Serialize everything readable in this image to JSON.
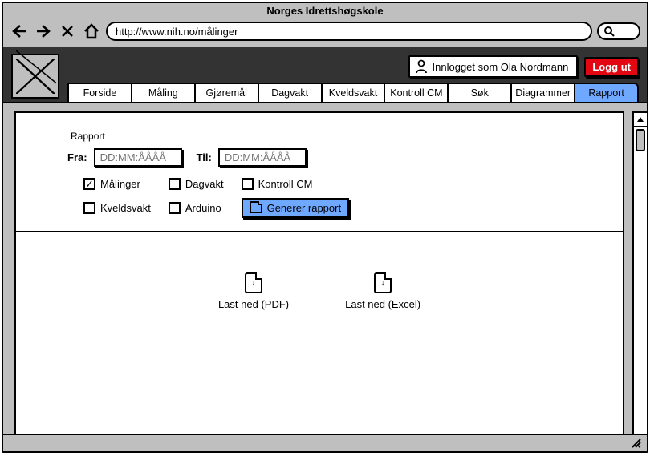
{
  "window": {
    "title": "Norges Idrettshøgskole",
    "url": "http://www.nih.no/målinger"
  },
  "header": {
    "logged_in_text": "Innlogget som Ola Nordmann",
    "logout_label": "Logg ut"
  },
  "tabs": [
    {
      "label": "Forside"
    },
    {
      "label": "Måling"
    },
    {
      "label": "Gjøremål"
    },
    {
      "label": "Dagvakt"
    },
    {
      "label": "Kveldsvakt"
    },
    {
      "label": "Kontroll CM"
    },
    {
      "label": "Søk"
    },
    {
      "label": "Diagrammer"
    },
    {
      "label": "Rapport",
      "active": true
    }
  ],
  "report": {
    "legend": "Rapport",
    "from_label": "Fra:",
    "to_label": "Til:",
    "date_placeholder": "DD:MM:ÅÅÅÅ",
    "checks": {
      "malinger": {
        "label": "Målinger",
        "checked": true
      },
      "dagvakt": {
        "label": "Dagvakt",
        "checked": false
      },
      "kontroll": {
        "label": "Kontroll CM",
        "checked": false
      },
      "kveldsvakt": {
        "label": "Kveldsvakt",
        "checked": false
      },
      "arduino": {
        "label": "Arduino",
        "checked": false
      }
    },
    "generate_label": "Generer rapport",
    "download_pdf": "Last ned (PDF)",
    "download_excel": "Last ned (Excel)"
  }
}
